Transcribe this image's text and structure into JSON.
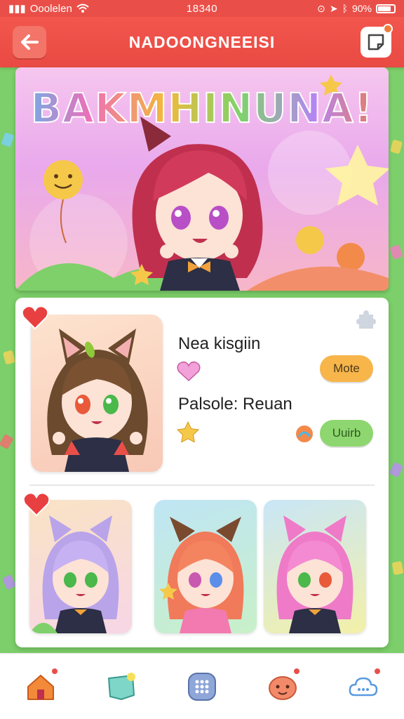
{
  "status_bar": {
    "carrier": "Ooolelen",
    "time": "18340",
    "battery": "90%"
  },
  "header": {
    "title": "NADOONGNEEISI"
  },
  "banner": {
    "title": "BAKMHINUNA!"
  },
  "profile": {
    "name": "Nea kisgiin",
    "subtitle": "Palsole: Reuan",
    "more_label": "Mote",
    "unlock_label": "Uuirb"
  },
  "nav": {
    "items": [
      "home-icon",
      "sticker-pack-icon",
      "keypad-icon",
      "pet-face-icon",
      "chat-cloud-icon"
    ]
  },
  "colors": {
    "accent": "#e94f48",
    "background": "#7ccf6a",
    "more_button": "#f7b54a",
    "unlock_button": "#8ed66f"
  }
}
